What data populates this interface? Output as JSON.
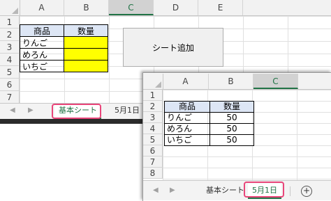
{
  "sheet1": {
    "columns": [
      "A",
      "B",
      "C",
      "D",
      "E"
    ],
    "selected_column": "C",
    "rows": [
      "1",
      "2",
      "3",
      "4",
      "5",
      "6",
      "7",
      "8"
    ],
    "table": {
      "header": [
        "商品",
        "数量"
      ],
      "items": [
        "りんご",
        "めろん",
        "いちご"
      ]
    },
    "button_label": "シート追加",
    "tabs": [
      "基本シート",
      "5月1日"
    ],
    "active_tab": "基本シート"
  },
  "sheet2": {
    "columns": [
      "A",
      "B",
      "C"
    ],
    "selected_column": "C",
    "rows": [
      "1",
      "2",
      "3",
      "4",
      "5",
      "6",
      "7",
      "8"
    ],
    "table": {
      "header": [
        "商品",
        "数量"
      ],
      "items": [
        "りんご",
        "めろん",
        "いちご"
      ],
      "quantities": [
        "50",
        "50",
        "50"
      ]
    },
    "tabs": [
      "基本シート",
      "5月1日"
    ],
    "active_tab": "5月1日"
  },
  "colors": {
    "header_fill": "#dde6f5",
    "empty_quantity_fill": "#ffff00",
    "excel_green": "#217346",
    "tab_highlight": "#e9467a"
  },
  "icons": [
    "scroll-left-icon",
    "scroll-right-icon",
    "add-sheet-icon"
  ]
}
